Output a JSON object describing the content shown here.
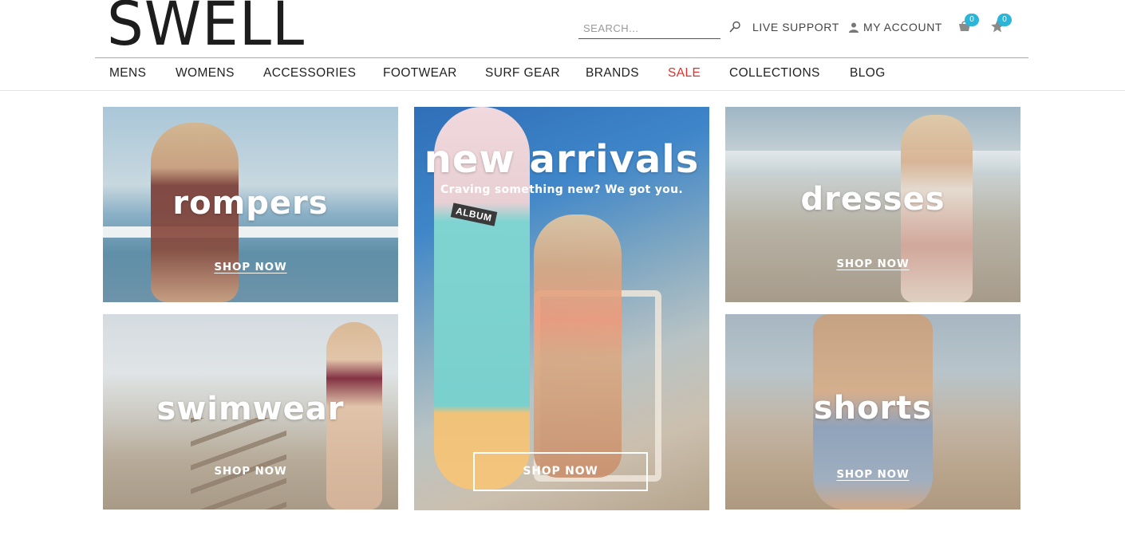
{
  "header": {
    "logo": "SWELL",
    "search_placeholder": "SEARCH...",
    "live_support": "LIVE SUPPORT",
    "my_account": "MY ACCOUNT",
    "cart_count": "0",
    "wishlist_count": "0",
    "badge_color": "#29b6d8"
  },
  "nav": {
    "items": [
      {
        "label": "MENS"
      },
      {
        "label": "WOMENS"
      },
      {
        "label": "ACCESSORIES"
      },
      {
        "label": "FOOTWEAR"
      },
      {
        "label": "SURF GEAR"
      },
      {
        "label": "BRANDS"
      },
      {
        "label": "SALE"
      },
      {
        "label": "COLLECTIONS"
      },
      {
        "label": "BLOG"
      }
    ],
    "sale_color": "#e0302b"
  },
  "tiles": {
    "rompers": {
      "title": "rompers",
      "cta": "SHOP NOW"
    },
    "swimwear": {
      "title": "swimwear",
      "cta": "SHOP NOW"
    },
    "new_arrivals": {
      "title": "new arrivals",
      "subtitle": "Craving something new? We got you.",
      "cta": "SHOP NOW",
      "board_label": "ALBUM"
    },
    "dresses": {
      "title": "dresses",
      "cta": "SHOP NOW"
    },
    "shorts": {
      "title": "shorts",
      "cta": "SHOP NOW"
    }
  },
  "icons": {
    "search": "search-icon",
    "account": "user-icon",
    "cart": "cart-icon",
    "wishlist": "star-icon"
  }
}
